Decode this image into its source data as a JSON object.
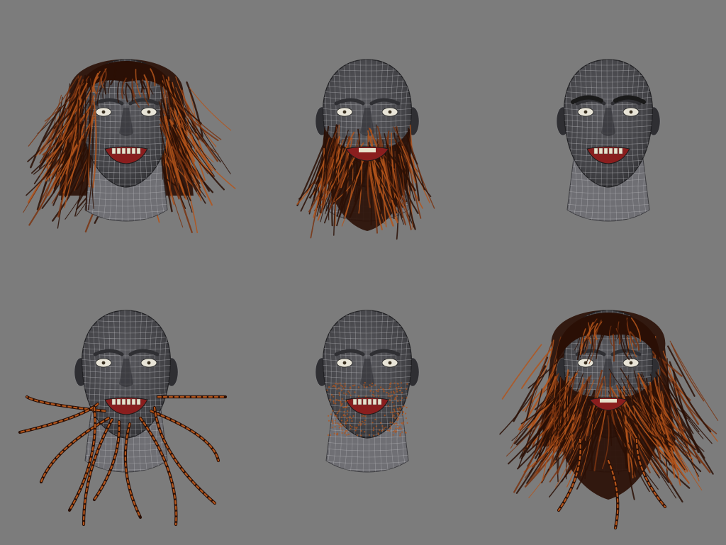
{
  "background": "#7c7c7c",
  "colors": {
    "skin": "#4a4a4e",
    "skin_shade": "#2f2f33",
    "wire": "#b9b9bd",
    "hair_light": "#b4551b",
    "hair_mid": "#7a3410",
    "hair_dark": "#2a0f05",
    "eye_white": "#e9e5d8",
    "mouth": "#8a1e1e",
    "teeth": "#e8e2cc"
  },
  "heads": [
    {
      "label": "long-hair-head",
      "hair": "long"
    },
    {
      "label": "full-beard-head",
      "hair": "beard"
    },
    {
      "label": "eyebrows-head",
      "hair": "eyebrows"
    },
    {
      "label": "braided-beard-head",
      "hair": "braids"
    },
    {
      "label": "stubble-head",
      "hair": "stubble"
    },
    {
      "label": "hair-and-beard-head",
      "hair": "full"
    }
  ]
}
